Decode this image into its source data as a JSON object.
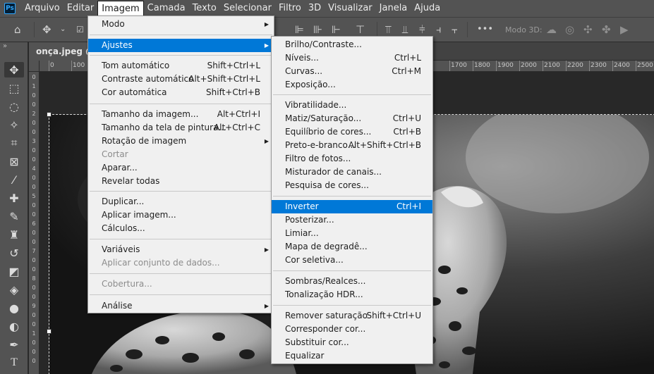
{
  "menubar": {
    "logo": "Ps",
    "items": [
      "Arquivo",
      "Editar",
      "Imagem",
      "Camada",
      "Texto",
      "Selecionar",
      "Filtro",
      "3D",
      "Visualizar",
      "Janela",
      "Ajuda"
    ],
    "active": "Imagem"
  },
  "optionsbar": {
    "modo3d": "Modo 3D:"
  },
  "tabs": {
    "doc": "onça.jpeg @ 3"
  },
  "rulers": {
    "top": [
      "0",
      "100",
      "1700",
      "1800",
      "1900",
      "2000",
      "2100",
      "2200",
      "2300",
      "2400",
      "2500"
    ],
    "left": [
      "0",
      "1",
      "0",
      "0",
      "2",
      "0",
      "0",
      "3",
      "0",
      "0",
      "4",
      "0",
      "0",
      "5",
      "0",
      "0",
      "6",
      "0",
      "0",
      "7",
      "0",
      "0",
      "8",
      "0",
      "0",
      "9",
      "0",
      "0",
      "1",
      "0",
      "0",
      "0"
    ]
  },
  "image_menu": {
    "items": [
      {
        "label": "Modo",
        "shortcut": "",
        "submenu": true,
        "state": "normal"
      },
      {
        "label": "Ajustes",
        "shortcut": "",
        "submenu": true,
        "state": "highlight"
      },
      {
        "label": "Tom automático",
        "shortcut": "Shift+Ctrl+L",
        "submenu": false,
        "state": "normal"
      },
      {
        "label": "Contraste automático",
        "shortcut": "Alt+Shift+Ctrl+L",
        "submenu": false,
        "state": "normal"
      },
      {
        "label": "Cor automática",
        "shortcut": "Shift+Ctrl+B",
        "submenu": false,
        "state": "normal"
      },
      {
        "label": "Tamanho da imagem...",
        "shortcut": "Alt+Ctrl+I",
        "submenu": false,
        "state": "normal"
      },
      {
        "label": "Tamanho da tela de pintura...",
        "shortcut": "Alt+Ctrl+C",
        "submenu": false,
        "state": "normal"
      },
      {
        "label": "Rotação de imagem",
        "shortcut": "",
        "submenu": true,
        "state": "normal"
      },
      {
        "label": "Cortar",
        "shortcut": "",
        "submenu": false,
        "state": "disabled"
      },
      {
        "label": "Aparar...",
        "shortcut": "",
        "submenu": false,
        "state": "normal"
      },
      {
        "label": "Revelar todas",
        "shortcut": "",
        "submenu": false,
        "state": "normal"
      },
      {
        "label": "Duplicar...",
        "shortcut": "",
        "submenu": false,
        "state": "normal"
      },
      {
        "label": "Aplicar imagem...",
        "shortcut": "",
        "submenu": false,
        "state": "normal"
      },
      {
        "label": "Cálculos...",
        "shortcut": "",
        "submenu": false,
        "state": "normal"
      },
      {
        "label": "Variáveis",
        "shortcut": "",
        "submenu": true,
        "state": "normal"
      },
      {
        "label": "Aplicar conjunto de dados...",
        "shortcut": "",
        "submenu": false,
        "state": "disabled"
      },
      {
        "label": "Cobertura...",
        "shortcut": "",
        "submenu": false,
        "state": "disabled"
      },
      {
        "label": "Análise",
        "shortcut": "",
        "submenu": true,
        "state": "normal"
      }
    ]
  },
  "adjust_menu": {
    "items": [
      {
        "label": "Brilho/Contraste...",
        "shortcut": "",
        "state": "normal"
      },
      {
        "label": "Níveis...",
        "shortcut": "Ctrl+L",
        "state": "normal"
      },
      {
        "label": "Curvas...",
        "shortcut": "Ctrl+M",
        "state": "normal"
      },
      {
        "label": "Exposição...",
        "shortcut": "",
        "state": "normal"
      },
      {
        "label": "Vibratilidade...",
        "shortcut": "",
        "state": "normal"
      },
      {
        "label": "Matiz/Saturação...",
        "shortcut": "Ctrl+U",
        "state": "normal"
      },
      {
        "label": "Equilíbrio de cores...",
        "shortcut": "Ctrl+B",
        "state": "normal"
      },
      {
        "label": "Preto-e-branco...",
        "shortcut": "Alt+Shift+Ctrl+B",
        "state": "normal"
      },
      {
        "label": "Filtro de fotos...",
        "shortcut": "",
        "state": "normal"
      },
      {
        "label": "Misturador de canais...",
        "shortcut": "",
        "state": "normal"
      },
      {
        "label": "Pesquisa de cores...",
        "shortcut": "",
        "state": "normal"
      },
      {
        "label": "Inverter",
        "shortcut": "Ctrl+I",
        "state": "highlight"
      },
      {
        "label": "Posterizar...",
        "shortcut": "",
        "state": "normal"
      },
      {
        "label": "Limiar...",
        "shortcut": "",
        "state": "normal"
      },
      {
        "label": "Mapa de degradê...",
        "shortcut": "",
        "state": "normal"
      },
      {
        "label": "Cor seletiva...",
        "shortcut": "",
        "state": "normal"
      },
      {
        "label": "Sombras/Realces...",
        "shortcut": "",
        "state": "normal"
      },
      {
        "label": "Tonalização HDR...",
        "shortcut": "",
        "state": "normal"
      },
      {
        "label": "Remover saturação",
        "shortcut": "Shift+Ctrl+U",
        "state": "normal"
      },
      {
        "label": "Corresponder cor...",
        "shortcut": "",
        "state": "normal"
      },
      {
        "label": "Substituir cor...",
        "shortcut": "",
        "state": "normal"
      },
      {
        "label": "Equalizar",
        "shortcut": "",
        "state": "normal"
      }
    ]
  },
  "colors": {
    "chrome": "#535353",
    "menu_bg": "#f0f0f0",
    "highlight": "#0078d7",
    "ps_blue": "#31a8ff"
  }
}
